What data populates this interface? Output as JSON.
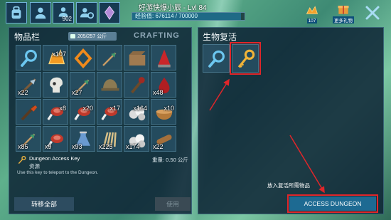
{
  "header": {
    "level_text": "好游快爆小辰 - Lvl 84",
    "xp_text": "经验值: 676114 / 700000",
    "xp_progress": 0.966,
    "player_count": "902"
  },
  "currency": {
    "amber_count": "107",
    "gift_label": "更多礼物"
  },
  "inventory": {
    "title": "物品栏",
    "crafting_tab": "CRAFTING",
    "capacity": "205/257 公斤",
    "slots": [
      {
        "icon": "magnifier-icon",
        "qty": ""
      },
      {
        "icon": "amber-icon",
        "qty": "x107"
      },
      {
        "icon": "fire-frame-icon",
        "qty": ""
      },
      {
        "icon": "arrow-icon",
        "qty": ""
      },
      {
        "icon": "crate-icon",
        "qty": ""
      },
      {
        "icon": "red-cone-icon",
        "qty": ""
      },
      {
        "icon": "spear-icon",
        "qty": "x22"
      },
      {
        "icon": "skull-icon",
        "qty": ""
      },
      {
        "icon": "arrow-icon",
        "qty": "x27"
      },
      {
        "icon": "helmet-icon",
        "qty": ""
      },
      {
        "icon": "torch-icon",
        "qty": ""
      },
      {
        "icon": "blood-icon",
        "qty": "x48"
      },
      {
        "icon": "club-icon",
        "qty": ""
      },
      {
        "icon": "meat-icon",
        "qty": "x8"
      },
      {
        "icon": "meat-icon",
        "qty": "x20"
      },
      {
        "icon": "meat-icon",
        "qty": "x17"
      },
      {
        "icon": "stone-icon",
        "qty": "x164"
      },
      {
        "icon": "bowl-icon",
        "qty": "x10"
      },
      {
        "icon": "arrow-icon",
        "qty": "x85"
      },
      {
        "icon": "meat-icon",
        "qty": "x9"
      },
      {
        "icon": "flask-icon",
        "qty": "x93"
      },
      {
        "icon": "sticks-icon",
        "qty": "x225"
      },
      {
        "icon": "stone-icon",
        "qty": "x174"
      },
      {
        "icon": "wood-icon",
        "qty": "x22"
      }
    ],
    "selected_name": "Dungeon Access Key",
    "selected_type": "资源",
    "selected_desc": "Use this key to teleport to the Dungeon.",
    "weight": "重量: 0.50 公斤",
    "transfer_all": "转移全部",
    "use": "使用"
  },
  "resurrection": {
    "title": "生物复活",
    "place_hint": "放入复活所需物品",
    "access_button": "ACCESS DUNGEON"
  },
  "colors": {
    "panel": "#0e2436",
    "highlight": "#e0262a",
    "accent_button": "#1d6a92"
  }
}
